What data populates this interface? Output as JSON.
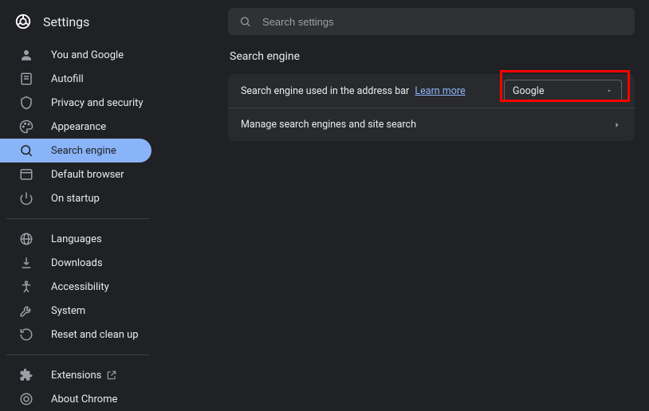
{
  "header": {
    "title": "Settings"
  },
  "search": {
    "placeholder": "Search settings"
  },
  "sidebar": {
    "group1": [
      {
        "label": "You and Google"
      },
      {
        "label": "Autofill"
      },
      {
        "label": "Privacy and security"
      },
      {
        "label": "Appearance"
      },
      {
        "label": "Search engine"
      },
      {
        "label": "Default browser"
      },
      {
        "label": "On startup"
      }
    ],
    "group2": [
      {
        "label": "Languages"
      },
      {
        "label": "Downloads"
      },
      {
        "label": "Accessibility"
      },
      {
        "label": "System"
      },
      {
        "label": "Reset and clean up"
      }
    ],
    "group3": [
      {
        "label": "Extensions"
      },
      {
        "label": "About Chrome"
      }
    ]
  },
  "main": {
    "title": "Search engine",
    "row1_prefix": "Search engine used in the address bar",
    "row1_link": "Learn more",
    "dropdown_value": "Google",
    "row2_label": "Manage search engines and site search"
  }
}
